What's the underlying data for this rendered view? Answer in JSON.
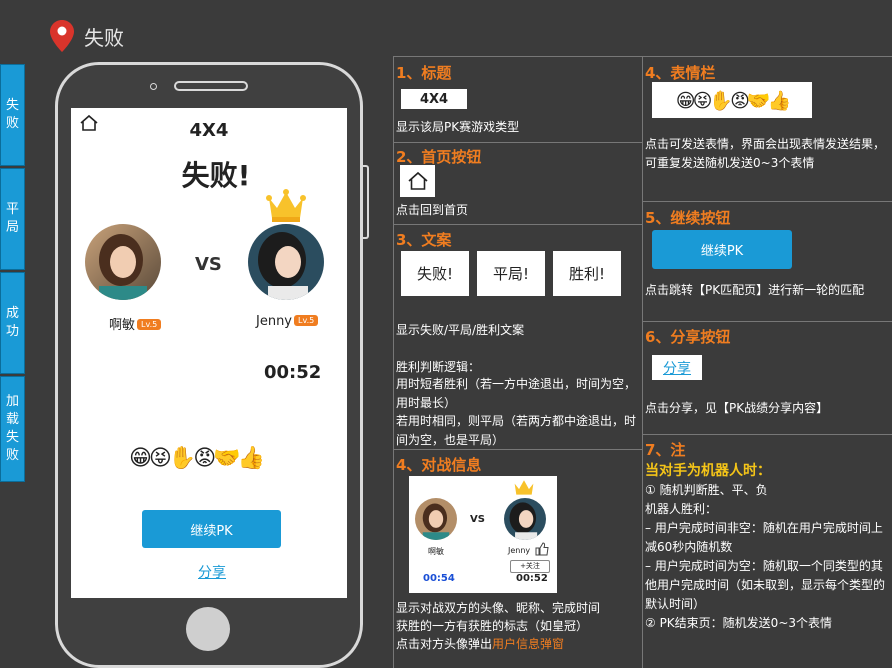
{
  "header": {
    "title": "失败"
  },
  "tabs": [
    "失败",
    "平局",
    "成功",
    "加载失败"
  ],
  "phone": {
    "mode": "4X4",
    "result": "失败!",
    "vs": "VS",
    "player1": {
      "name": "啊敏",
      "level": "Lv.5"
    },
    "player2": {
      "name": "Jenny",
      "level": "Lv.5"
    },
    "time": "00:52",
    "emojis": "😁😝✋😡🤝👍",
    "continue_label": "继续PK",
    "share_label": "分享"
  },
  "notes": {
    "n1": {
      "title": "1、标题",
      "box": "4X4",
      "desc": "显示该局PK赛游戏类型"
    },
    "n2": {
      "title": "2、首页按钮",
      "desc": "点击回到首页"
    },
    "n3": {
      "title": "3、文案",
      "labels": [
        "失败!",
        "平局!",
        "胜利!"
      ],
      "desc1": "显示失败/平局/胜利文案",
      "desc2": "胜利判断逻辑：",
      "desc3": "用时短者胜利（若一方中途退出，时间为空，用时最长）",
      "desc4": "若用时相同，则平局（若两方都中途退出，时间为空，也是平局）"
    },
    "n4b": {
      "title": "4、对战信息",
      "thumb": {
        "vs": "VS",
        "name1": "啊敏",
        "name2": "Jenny",
        "follow": "+关注",
        "time1": "00:54",
        "time2": "00:52"
      },
      "desc1": "显示对战双方的头像、昵称、完成时间",
      "desc2": "获胜的一方有获胜的标志（如皇冠）",
      "desc3_prefix": "点击对方头像弹出",
      "desc3_link": "用户信息弹窗"
    },
    "n4a": {
      "title": "4、表情栏",
      "emojis": "😁😝✋😡🤝👍",
      "desc": "点击可发送表情，界面会出现表情发送结果，可重复发送随机发送0~3个表情"
    },
    "n5": {
      "title": "5、继续按钮",
      "button": "继续PK",
      "desc": "点击跳转【PK匹配页】进行新一轮的匹配"
    },
    "n6": {
      "title": "6、分享按钮",
      "button": "分享",
      "desc": "点击分享，见【PK战绩分享内容】"
    },
    "n7": {
      "title": "7、注",
      "subtitle": "当对手为机器人时：",
      "lines": [
        "① 随机判断胜、平、负",
        "机器人胜利：",
        "– 用户完成时间非空：随机在用户完成时间上减60秒内随机数",
        "– 用户完成时间为空：随机取一个同类型的其他用户完成时间（如未取到，显示每个类型的默认时间）",
        "② PK结束页：随机发送0~3个表情"
      ]
    }
  },
  "colors": {
    "accent": "#1a9ad6",
    "orange": "#f07d20",
    "yellow": "#f5c518",
    "bg": "#3b3b3b"
  }
}
